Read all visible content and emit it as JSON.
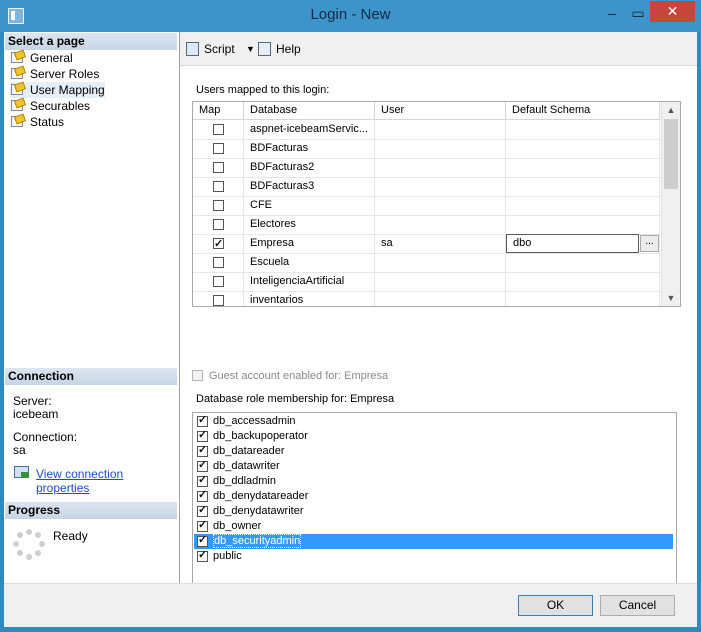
{
  "window": {
    "title": "Login - New"
  },
  "left": {
    "select_header": "Select a page",
    "pages": [
      {
        "label": "General"
      },
      {
        "label": "Server Roles"
      },
      {
        "label": "User Mapping"
      },
      {
        "label": "Securables"
      },
      {
        "label": "Status"
      }
    ],
    "connection_header": "Connection",
    "server_label": "Server:",
    "server_value": "icebeam",
    "connection_label": "Connection:",
    "connection_value": "sa",
    "view_props_link": "View connection properties",
    "progress_header": "Progress",
    "progress_status": "Ready"
  },
  "toolbar": {
    "script_label": "Script",
    "help_label": "Help"
  },
  "users_mapped": {
    "label": "Users mapped to this login:",
    "columns": [
      "Map",
      "Database",
      "User",
      "Default Schema"
    ],
    "rows": [
      {
        "map": false,
        "database": "aspnet-icebeamServic...",
        "user": "",
        "schema": ""
      },
      {
        "map": false,
        "database": "BDFacturas",
        "user": "",
        "schema": ""
      },
      {
        "map": false,
        "database": "BDFacturas2",
        "user": "",
        "schema": ""
      },
      {
        "map": false,
        "database": "BDFacturas3",
        "user": "",
        "schema": ""
      },
      {
        "map": false,
        "database": "CFE",
        "user": "",
        "schema": ""
      },
      {
        "map": false,
        "database": "Electores",
        "user": "",
        "schema": ""
      },
      {
        "map": true,
        "database": "Empresa",
        "user": "sa",
        "schema": "dbo"
      },
      {
        "map": false,
        "database": "Escuela",
        "user": "",
        "schema": ""
      },
      {
        "map": false,
        "database": "InteligenciaArtificial",
        "user": "",
        "schema": ""
      },
      {
        "map": false,
        "database": "inventarios",
        "user": "",
        "schema": ""
      }
    ],
    "ellipsis": "..."
  },
  "guest": {
    "label": "Guest account enabled for: Empresa",
    "checked": false
  },
  "roles": {
    "label": "Database role membership for: Empresa",
    "items": [
      {
        "name": "db_accessadmin",
        "checked": true
      },
      {
        "name": "db_backupoperator",
        "checked": true
      },
      {
        "name": "db_datareader",
        "checked": true
      },
      {
        "name": "db_datawriter",
        "checked": true
      },
      {
        "name": "db_ddladmin",
        "checked": true
      },
      {
        "name": "db_denydatareader",
        "checked": true
      },
      {
        "name": "db_denydatawriter",
        "checked": true
      },
      {
        "name": "db_owner",
        "checked": true
      },
      {
        "name": "db_securityadmin",
        "checked": true,
        "selected": true
      },
      {
        "name": "public",
        "checked": true
      }
    ]
  },
  "buttons": {
    "ok": "OK",
    "cancel": "Cancel"
  }
}
